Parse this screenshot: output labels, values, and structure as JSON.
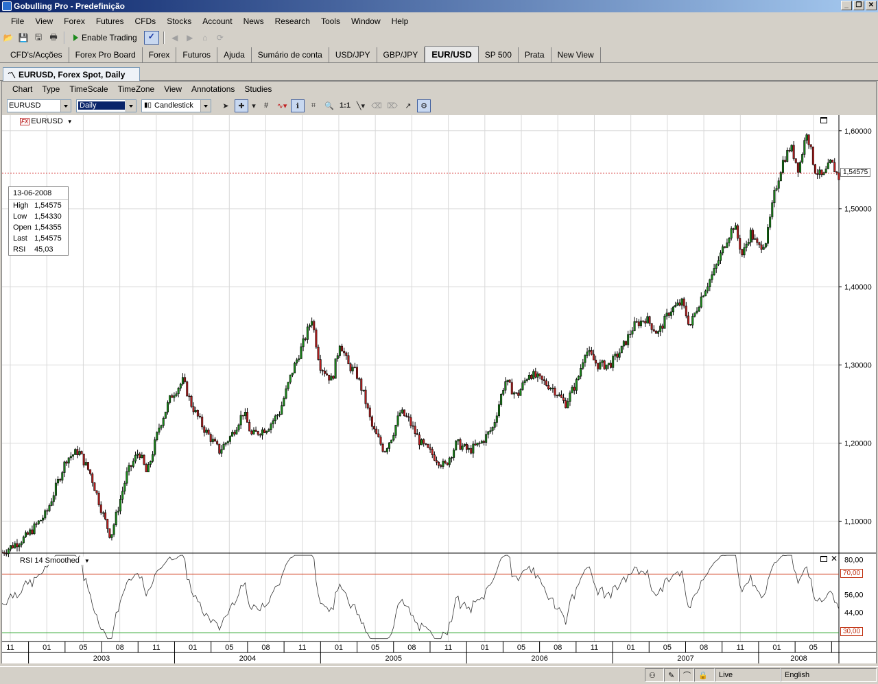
{
  "window": {
    "title": "Gobulling Pro - Predefinição"
  },
  "menu": [
    "File",
    "View",
    "Forex",
    "Futures",
    "CFDs",
    "Stocks",
    "Account",
    "News",
    "Research",
    "Tools",
    "Window",
    "Help"
  ],
  "toolbar": {
    "enable_trading": "Enable Trading"
  },
  "tabs": [
    {
      "label": "CFD's/Acções",
      "active": false
    },
    {
      "label": "Forex Pro Board",
      "active": false
    },
    {
      "label": "Forex",
      "active": false
    },
    {
      "label": "Futuros",
      "active": false
    },
    {
      "label": "Ajuda",
      "active": false
    },
    {
      "label": "Sumário de conta",
      "active": false
    },
    {
      "label": "USD/JPY",
      "active": false
    },
    {
      "label": "GBP/JPY",
      "active": false
    },
    {
      "label": "EUR/USD",
      "active": true
    },
    {
      "label": "SP 500",
      "active": false
    },
    {
      "label": "Prata",
      "active": false
    },
    {
      "label": "New View",
      "active": false
    }
  ],
  "chart_window": {
    "title": "EURUSD, Forex Spot, Daily",
    "menu": [
      "Chart",
      "Type",
      "TimeScale",
      "TimeZone",
      "View",
      "Annotations",
      "Studies"
    ],
    "symbol": "EURUSD",
    "interval": "Daily",
    "chart_type": "Candlestick"
  },
  "chart_data": {
    "type": "candlestick",
    "symbol": "EURUSD",
    "price_axis": {
      "ticks": [
        "1,60000",
        "1,50000",
        "1,40000",
        "1,30000",
        "1,20000",
        "1,10000"
      ],
      "range": [
        1.06,
        1.62
      ]
    },
    "last_price_label": "1,54575",
    "last_price": 1.54575,
    "info": {
      "date": "13-06-2008",
      "rows": [
        {
          "k": "High",
          "v": "1,54575"
        },
        {
          "k": "Low",
          "v": "1,54330"
        },
        {
          "k": "Open",
          "v": "1,54355"
        },
        {
          "k": "Last",
          "v": "1,54575"
        },
        {
          "k": "RSI",
          "v": "45,03"
        }
      ]
    },
    "anchors": [
      [
        0.0,
        1.06
      ],
      [
        0.03,
        1.08
      ],
      [
        0.055,
        1.11
      ],
      [
        0.08,
        1.18
      ],
      [
        0.095,
        1.19
      ],
      [
        0.11,
        1.16
      ],
      [
        0.125,
        1.11
      ],
      [
        0.135,
        1.08
      ],
      [
        0.155,
        1.16
      ],
      [
        0.17,
        1.19
      ],
      [
        0.18,
        1.16
      ],
      [
        0.195,
        1.22
      ],
      [
        0.21,
        1.26
      ],
      [
        0.225,
        1.28
      ],
      [
        0.235,
        1.25
      ],
      [
        0.25,
        1.22
      ],
      [
        0.27,
        1.19
      ],
      [
        0.285,
        1.21
      ],
      [
        0.3,
        1.24
      ],
      [
        0.31,
        1.21
      ],
      [
        0.33,
        1.22
      ],
      [
        0.345,
        1.24
      ],
      [
        0.36,
        1.29
      ],
      [
        0.375,
        1.33
      ],
      [
        0.385,
        1.36
      ],
      [
        0.395,
        1.3
      ],
      [
        0.41,
        1.28
      ],
      [
        0.42,
        1.33
      ],
      [
        0.43,
        1.3
      ],
      [
        0.44,
        1.29
      ],
      [
        0.45,
        1.26
      ],
      [
        0.46,
        1.22
      ],
      [
        0.475,
        1.19
      ],
      [
        0.485,
        1.21
      ],
      [
        0.495,
        1.24
      ],
      [
        0.505,
        1.23
      ],
      [
        0.52,
        1.2
      ],
      [
        0.54,
        1.18
      ],
      [
        0.55,
        1.17
      ],
      [
        0.565,
        1.2
      ],
      [
        0.58,
        1.19
      ],
      [
        0.595,
        1.2
      ],
      [
        0.61,
        1.22
      ],
      [
        0.625,
        1.28
      ],
      [
        0.64,
        1.26
      ],
      [
        0.655,
        1.29
      ],
      [
        0.67,
        1.28
      ],
      [
        0.685,
        1.27
      ],
      [
        0.7,
        1.25
      ],
      [
        0.715,
        1.28
      ],
      [
        0.725,
        1.32
      ],
      [
        0.74,
        1.3
      ],
      [
        0.755,
        1.3
      ],
      [
        0.77,
        1.32
      ],
      [
        0.785,
        1.35
      ],
      [
        0.8,
        1.36
      ],
      [
        0.815,
        1.34
      ],
      [
        0.83,
        1.37
      ],
      [
        0.845,
        1.38
      ],
      [
        0.855,
        1.35
      ],
      [
        0.87,
        1.39
      ],
      [
        0.885,
        1.42
      ],
      [
        0.9,
        1.46
      ],
      [
        0.91,
        1.48
      ],
      [
        0.92,
        1.44
      ],
      [
        0.93,
        1.47
      ],
      [
        0.94,
        1.45
      ],
      [
        0.95,
        1.46
      ],
      [
        0.96,
        1.52
      ],
      [
        0.97,
        1.56
      ],
      [
        0.98,
        1.58
      ],
      [
        0.99,
        1.55
      ],
      [
        1.0,
        1.6
      ],
      [
        1.01,
        1.55
      ],
      [
        1.02,
        1.54
      ],
      [
        1.03,
        1.56
      ],
      [
        1.04,
        1.54
      ]
    ]
  },
  "rsi": {
    "label": "RSI 14 Smoothed",
    "ticks": [
      "80,00",
      "56,00",
      "44,00"
    ],
    "overbought_label": "70,00",
    "oversold_label": "30,00",
    "overbought": 70,
    "oversold": 30,
    "range": [
      24,
      84
    ]
  },
  "time_axis": {
    "months": [
      "11",
      "01",
      "05",
      "08",
      "11",
      "01",
      "05",
      "08",
      "11",
      "01",
      "05",
      "08",
      "11",
      "01",
      "05",
      "08",
      "11",
      "01",
      "05",
      "08",
      "11",
      "01",
      "05"
    ],
    "years": [
      "2003",
      "2004",
      "2005",
      "2006",
      "2007",
      "2008"
    ]
  },
  "status": {
    "connection": "Live",
    "language": "English"
  },
  "colors": {
    "down_candle": "#c02020",
    "up_candle": "#1a8a1a",
    "price_line": "#d02020",
    "overbought": "#d04020",
    "oversold": "#20a020"
  }
}
